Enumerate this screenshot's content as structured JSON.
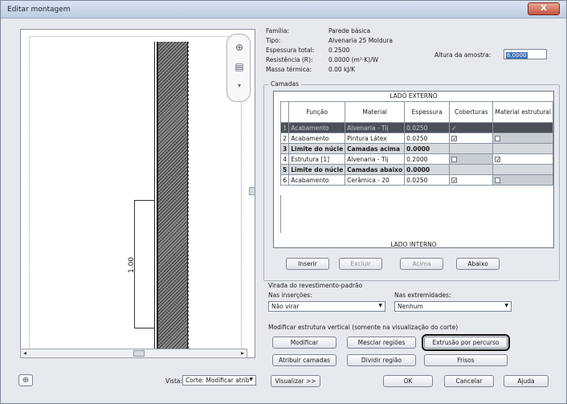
{
  "window": {
    "title": "Editar montagem",
    "close_glyph": "X"
  },
  "preview": {
    "dimension_label": "1.00",
    "nav_icons": [
      "zoom-icon",
      "pan-icon"
    ]
  },
  "properties": {
    "familia_label": "Família:",
    "familia_value": "Parede básica",
    "tipo_label": "Tipo:",
    "tipo_value": "Alvenaria 25 Moldura",
    "espessura_label": "Espessura total:",
    "espessura_value": "0.2500",
    "resistencia_label": "Resistência (R):",
    "resistencia_value": "0.0000 (m²·K)/W",
    "massa_label": "Massa térmica:",
    "massa_value": "0.00 kJ/K",
    "sample_label": "Altura da amostra:",
    "sample_value": "6.0000"
  },
  "layers": {
    "group_label": "Camadas",
    "top_label": "LADO EXTERNO",
    "bottom_label": "LADO INTERNO",
    "headers": [
      "Função",
      "Material",
      "Espessura",
      "Coberturas",
      "Material estrutural"
    ],
    "rows": [
      {
        "n": "1",
        "funcao": "Acabamento",
        "material": "Alvenaria - Tij",
        "espessura": "0.0250",
        "coberturas": "✓",
        "estrutural": ""
      },
      {
        "n": "2",
        "funcao": "Acabamento",
        "material": "Pintura Látex",
        "espessura": "0.0250",
        "coberturas": "✓",
        "estrutural": ""
      },
      {
        "n": "3",
        "funcao": "Limite do núcle",
        "material": "Camadas acima",
        "espessura": "0.0000",
        "coberturas": "",
        "estrutural": ""
      },
      {
        "n": "4",
        "funcao": "Estrutura [1]",
        "material": "Alvenaria - Tij",
        "espessura": "0.2000",
        "coberturas": "",
        "estrutural": "✓"
      },
      {
        "n": "5",
        "funcao": "Limite do núcle",
        "material": "Camadas abaixo",
        "espessura": "0.0000",
        "coberturas": "",
        "estrutural": ""
      },
      {
        "n": "6",
        "funcao": "Acabamento",
        "material": "Cerâmica - 20",
        "espessura": "0.0250",
        "coberturas": "✓",
        "estrutural": ""
      }
    ],
    "buttons": {
      "inserir": "Inserir",
      "excluir": "Excluir",
      "acima": "Acima",
      "abaixo": "Abaixo"
    }
  },
  "wrapping": {
    "title": "Virada do revestimento-padrão",
    "insercoes_label": "Nas inserções:",
    "insercoes_value": "Não virar",
    "extremidades_label": "Nas extremidades:",
    "extremidades_value": "Nenhum"
  },
  "vertical": {
    "title": "Modificar estrutura vertical (somente na visualização do corte)",
    "modificar": "Modificar",
    "mesclar": "Mesclar regiões",
    "extrusao": "Extrusão por percurso",
    "atribuir": "Atribuir camadas",
    "dividir": "Dividir região",
    "frisos": "Frisos"
  },
  "footer": {
    "vista_label": "Vista:",
    "vista_value": "Corte: Modificar atrib",
    "visualizar": "Visualizar >>",
    "ok": "OK",
    "cancelar": "Cancelar",
    "ajuda": "Ajuda"
  }
}
